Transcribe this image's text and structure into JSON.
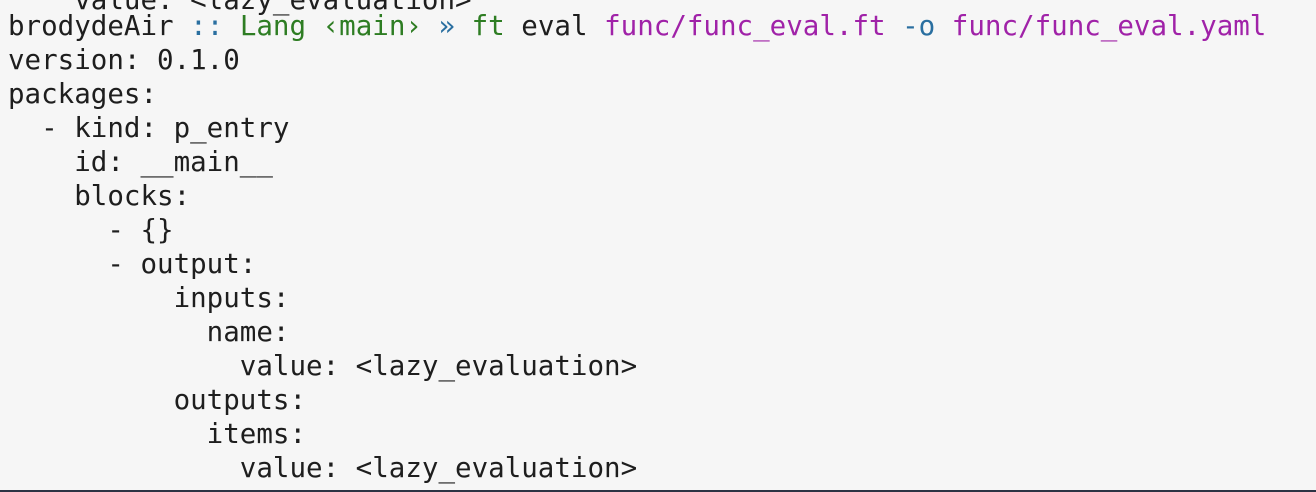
{
  "terminal": {
    "clipped_line": "    value: <lazy_evaluation>",
    "prompt": {
      "host": "brodydeAir",
      "separator": " :: ",
      "directory": "Lang",
      "branch": " ‹main›",
      "arrow": " » ",
      "command": "ft",
      "subcommand": " eval ",
      "input_path": "func/func_eval.ft",
      "flag": " -o ",
      "output_path": "func/func_eval.yaml"
    },
    "output_lines": [
      "version: 0.1.0",
      "packages:",
      "  - kind: p_entry",
      "    id: __main__",
      "    blocks:",
      "      - {}",
      "      - output:",
      "          inputs:",
      "            name:",
      "              value: <lazy_evaluation>",
      "          outputs:",
      "            items:",
      "              value: <lazy_evaluation>"
    ]
  },
  "colors": {
    "background": "#f6f6f6",
    "text": "#1e1e1e",
    "green": "#2e7d23",
    "blue": "#2a6fa0",
    "magenta": "#a022a8"
  }
}
